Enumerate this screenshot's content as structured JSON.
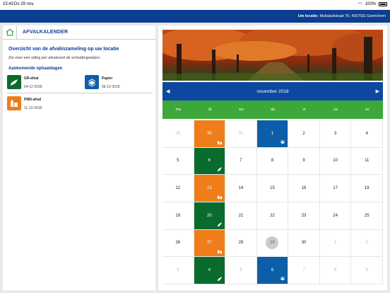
{
  "status": {
    "time": "15:43",
    "date": "Do 29 nov.",
    "battery": "100%"
  },
  "topbar": {
    "location_label": "Uw locatie:",
    "location_value": "Multatulistraat 70, 4207SG Gorinchem"
  },
  "left": {
    "title": "AFVALKALENDER",
    "heading": "Overzicht van de afvalinzameling op uw locatie",
    "intro": "Zie voor een uitleg per afvalsoort de scheidingswijzer.",
    "upcoming_title": "Aankomende ophaaldagen",
    "pickups": [
      {
        "name": "GR-afval",
        "date": "04-12-2018",
        "color": "#0a6b2e",
        "icon": "gft-icon"
      },
      {
        "name": "Papier",
        "date": "06-12-2018",
        "color": "#0d5ea8",
        "icon": "paper-icon"
      },
      {
        "name": "PMD-afval",
        "date": "11-12-2018",
        "color": "#ef7d1a",
        "icon": "pmd-icon"
      }
    ]
  },
  "calendar": {
    "month": "november 2018",
    "prev_icon": "◀",
    "next_icon": "▶",
    "weekdays": [
      "ma",
      "di",
      "wo",
      "do",
      "vr",
      "za",
      "zo"
    ],
    "weeks": [
      [
        {
          "d": "29",
          "o": true
        },
        {
          "d": "30",
          "c": "orange",
          "i": "pmd"
        },
        {
          "d": "31",
          "o": true
        },
        {
          "d": "1",
          "c": "blue",
          "i": "paper"
        },
        {
          "d": "2"
        },
        {
          "d": "3"
        },
        {
          "d": "4"
        }
      ],
      [
        {
          "d": "5"
        },
        {
          "d": "6",
          "c": "green",
          "i": "gft"
        },
        {
          "d": "7"
        },
        {
          "d": "8"
        },
        {
          "d": "9"
        },
        {
          "d": "10"
        },
        {
          "d": "11"
        }
      ],
      [
        {
          "d": "12"
        },
        {
          "d": "13",
          "c": "orange",
          "i": "pmd"
        },
        {
          "d": "14"
        },
        {
          "d": "15"
        },
        {
          "d": "16"
        },
        {
          "d": "17"
        },
        {
          "d": "18"
        }
      ],
      [
        {
          "d": "19"
        },
        {
          "d": "20",
          "c": "green",
          "i": "gft"
        },
        {
          "d": "21"
        },
        {
          "d": "22"
        },
        {
          "d": "23"
        },
        {
          "d": "24"
        },
        {
          "d": "25"
        }
      ],
      [
        {
          "d": "26"
        },
        {
          "d": "27",
          "c": "orange",
          "i": "pmd"
        },
        {
          "d": "28"
        },
        {
          "d": "29",
          "t": true
        },
        {
          "d": "30"
        },
        {
          "d": "1",
          "o": true
        },
        {
          "d": "2",
          "o": true
        }
      ],
      [
        {
          "d": "3",
          "o": true
        },
        {
          "d": "4",
          "c": "green",
          "i": "gft"
        },
        {
          "d": "5",
          "o": true
        },
        {
          "d": "6",
          "c": "blue",
          "i": "paper"
        },
        {
          "d": "7",
          "o": true
        },
        {
          "d": "8",
          "o": true
        },
        {
          "d": "9",
          "o": true
        }
      ]
    ]
  }
}
